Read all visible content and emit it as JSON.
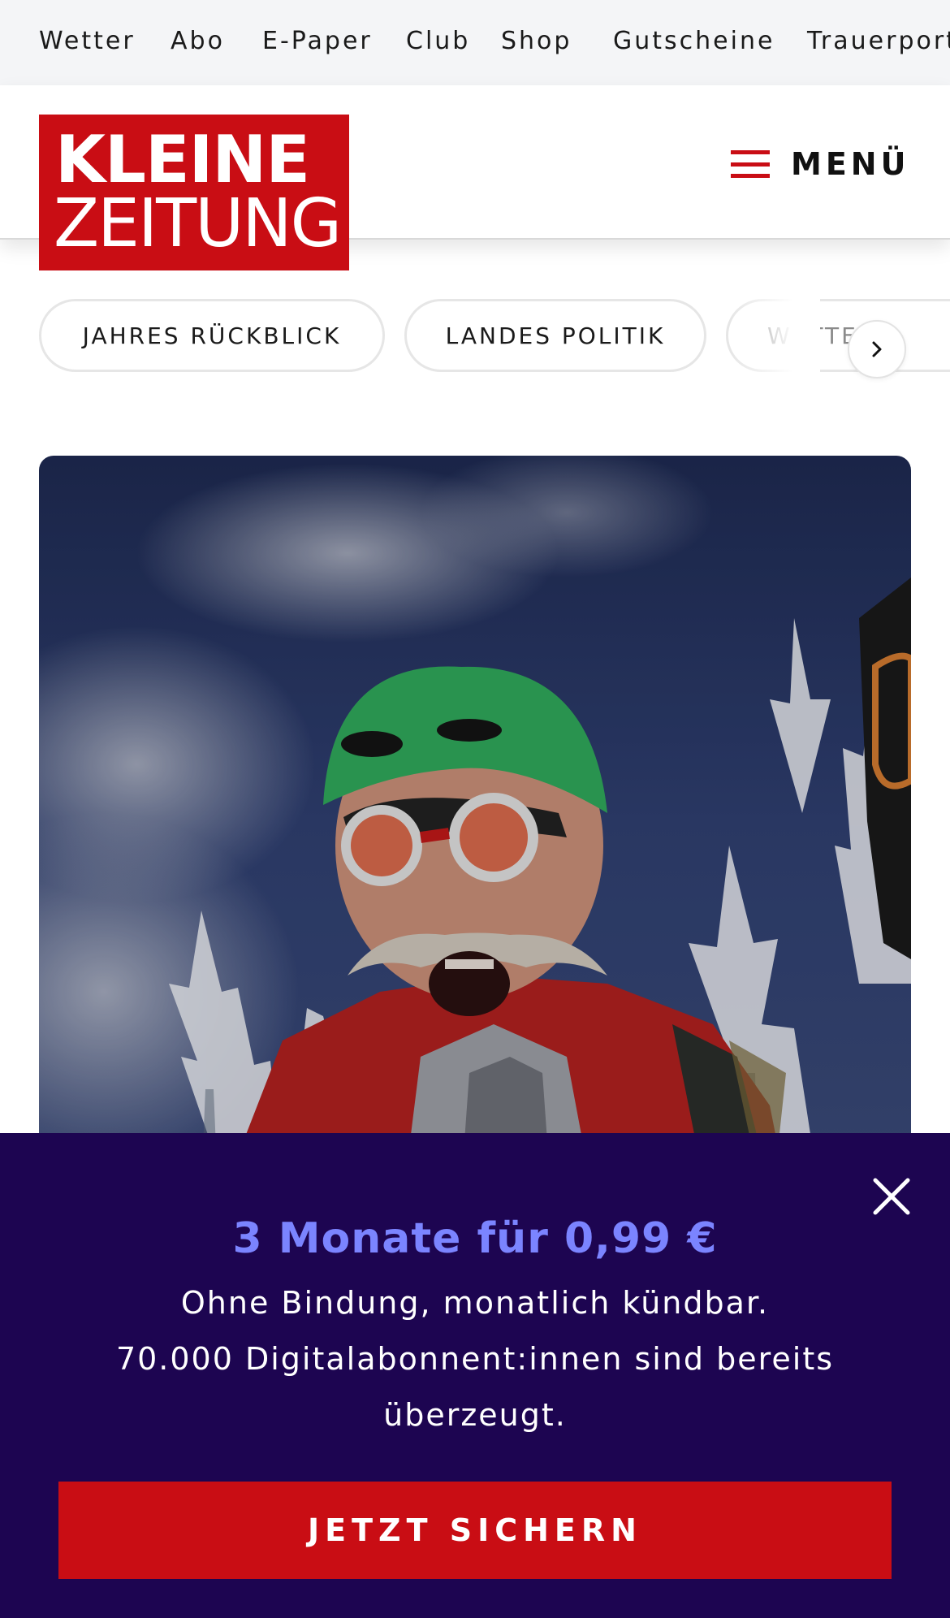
{
  "topbar": {
    "items": [
      "Wetter",
      "Abo",
      "E-Paper",
      "Club",
      "Shop",
      "Gutscheine",
      "Trauerportal"
    ]
  },
  "header": {
    "logo_line1": "KLEINE",
    "logo_line2": "ZEITUNG",
    "menu_label": "MENÜ",
    "menu_icon": "hamburger-icon"
  },
  "topics": {
    "pills": [
      "JAHRES RÜCKBLICK",
      "LANDES POLITIK",
      "WETTER"
    ],
    "next_icon": "chevron-right-icon"
  },
  "hero": {
    "image": "man-with-green-cap-and-ski-goggles-in-snowy-forest"
  },
  "promo": {
    "headline": "3 Monate für 0,99 €",
    "line1": "Ohne Bindung, monatlich kündbar.",
    "line2": "70.000 Digitalabonnent:innen sind bereits überzeugt.",
    "cta_label": "JETZT SICHERN",
    "close_icon": "close-icon"
  },
  "colors": {
    "brand_red": "#c90d14",
    "promo_bg": "#1d0551",
    "promo_headline": "#7b84ff",
    "topbar_bg": "#f4f5f7"
  }
}
